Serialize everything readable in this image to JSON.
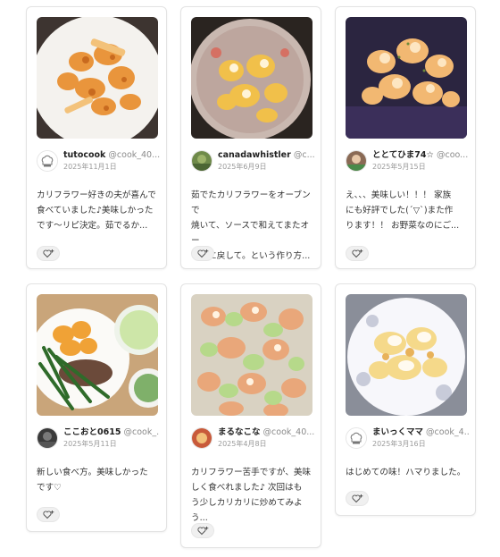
{
  "reports": [
    {
      "username": "tutocook",
      "handle": "@cook_40...",
      "date": "2025年11月1日",
      "comment_lines": [
        "カリフラワー好きの夫が喜んで",
        "食べていました♪美味しかった",
        "です〜リピ決定。茹でるか..."
      ]
    },
    {
      "username": "canadawhistler",
      "handle": "@c...",
      "date": "2025年6月9日",
      "comment_lines": [
        "茹でたカリフラワーをオーブンで",
        "焼いて、ソースで和えてまたオー",
        "ブンに戻して。という作り方..."
      ]
    },
    {
      "username": "ととてひま74☆",
      "handle": "@coo...",
      "date": "2025年5月15日",
      "comment_lines": [
        "え、、、美味しい！！！ 家族",
        "にも好評でした(´▽`)また作",
        "ります！！ お野菜なのにご..."
      ]
    },
    {
      "username": "ここおと0615",
      "handle": "@cook_...",
      "date": "2025年5月11日",
      "comment_lines": [
        "新しい食べ方。美味しかった",
        "です♡"
      ]
    },
    {
      "username": "まるなこな",
      "handle": "@cook_40...",
      "date": "2025年4月8日",
      "comment_lines": [
        "カリフラワー苦手ですが、美味",
        "しく食べれました♪ 次回はも",
        "う少しカリカリに炒めてみよう..."
      ]
    },
    {
      "username": "まいっくママ",
      "handle": "@cook_4...",
      "date": "2025年3月16日",
      "comment_lines": [
        "はじめての味！ハマりました。"
      ]
    }
  ],
  "icons": {
    "like": "heart-plus-icon",
    "default_avatar": "chef-hat-icon"
  }
}
